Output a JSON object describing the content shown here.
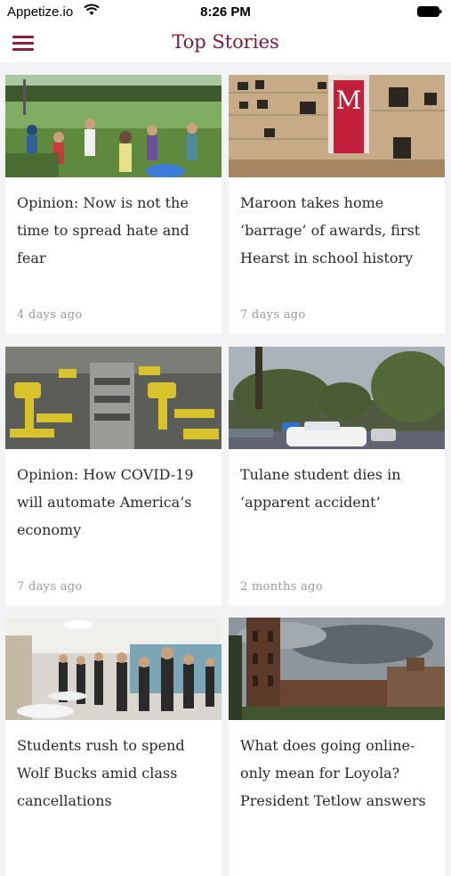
{
  "status_bar": {
    "carrier": "Appetize.io",
    "time": "8:26 PM"
  },
  "header": {
    "title": "Top Stories"
  },
  "stories": [
    {
      "headline": "Opinion: Now is not the time to spread hate and fear",
      "age": "4 days ago"
    },
    {
      "headline": "Maroon takes home ‘barrage’ of awards, first Hearst in school history",
      "age": "7 days ago"
    },
    {
      "headline": "Opinion: How COVID-19 will automate America’s economy",
      "age": "7 days ago"
    },
    {
      "headline": "Tulane student dies in ‘apparent accident’",
      "age": "2 months ago"
    },
    {
      "headline": "Students rush to spend Wolf Bucks amid class cancellations",
      "age": ""
    },
    {
      "headline": "What does going online-only mean for Loyola? President Tetlow answers",
      "age": ""
    }
  ],
  "banner_letter": "M",
  "colors": {
    "brand": "#7d1a36",
    "background": "#f3f2f4"
  }
}
